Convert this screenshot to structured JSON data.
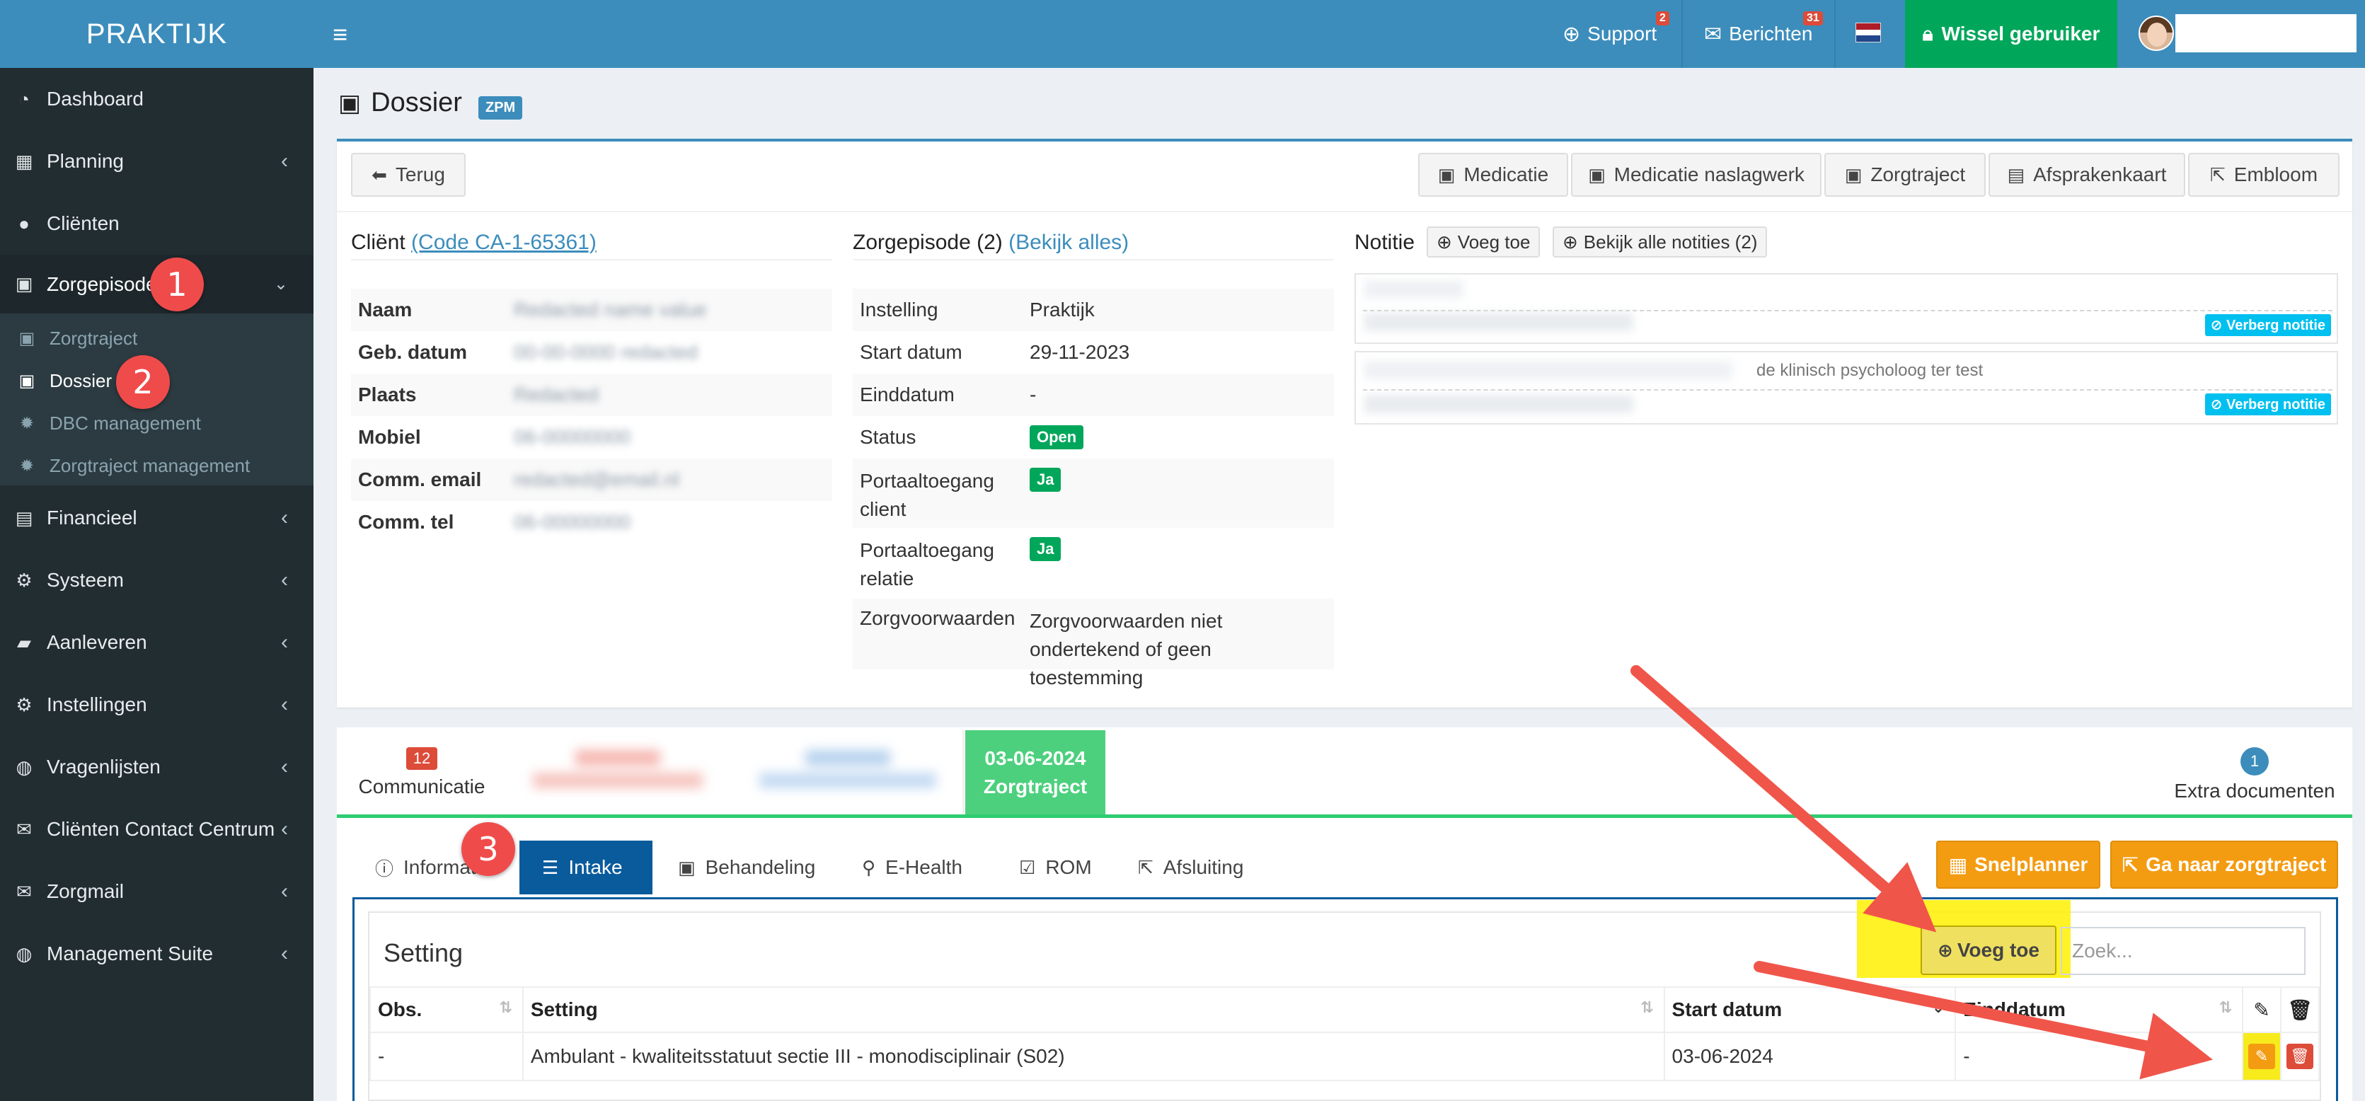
{
  "app": {
    "logo": "PRAKTIJK"
  },
  "sidebar": {
    "items": [
      {
        "label": "Dashboard",
        "icon": "dashboard-icon"
      },
      {
        "label": "Planning",
        "icon": "calendar-icon"
      },
      {
        "label": "Cliënten",
        "icon": "user-icon"
      },
      {
        "label": "Zorgepisode",
        "icon": "medkit-icon"
      },
      {
        "label": "Financieel",
        "icon": "book-icon"
      },
      {
        "label": "Systeem",
        "icon": "cogs-icon"
      },
      {
        "label": "Aanleveren",
        "icon": "truck-icon"
      },
      {
        "label": "Instellingen",
        "icon": "gear-icon"
      },
      {
        "label": "Vragenlijsten",
        "icon": "globe-icon"
      },
      {
        "label": "Cliënten Contact Centrum",
        "icon": "envelope-icon"
      },
      {
        "label": "Zorgmail",
        "icon": "envelope-icon"
      },
      {
        "label": "Management Suite",
        "icon": "globe-icon"
      }
    ],
    "submenu": [
      {
        "label": "Zorgtraject"
      },
      {
        "label": "Dossier"
      },
      {
        "label": "DBC management"
      },
      {
        "label": "Zorgtraject management"
      }
    ]
  },
  "topbar": {
    "support_label": "Support",
    "support_badge": "2",
    "messages_label": "Berichten",
    "messages_badge": "31",
    "switch_user_label": "Wissel gebruiker"
  },
  "page": {
    "title": "Dossier",
    "badge": "ZPM"
  },
  "actions": {
    "back": "Terug",
    "medication": "Medicatie",
    "medication_ref": "Medicatie naslagwerk",
    "care_track": "Zorgtraject",
    "appointment_card": "Afsprakenkaart",
    "embloom": "Embloom"
  },
  "client": {
    "title_prefix": "Cliënt",
    "code_link": "(Code CA-1-65361)",
    "rows": [
      {
        "key": "Naam",
        "value": "Redacted name value"
      },
      {
        "key": "Geb. datum",
        "value": "00-00-0000 redacted"
      },
      {
        "key": "Plaats",
        "value": "Redacted"
      },
      {
        "key": "Mobiel",
        "value": "06-00000000"
      },
      {
        "key": "Comm. email",
        "value": "redacted@email.nl"
      },
      {
        "key": "Comm. tel",
        "value": "06-00000000"
      }
    ]
  },
  "episode": {
    "title_prefix": "Zorgepisode (2)",
    "view_all": "(Bekijk alles)",
    "rows": [
      {
        "key": "Instelling",
        "value": "Praktijk"
      },
      {
        "key": "Start datum",
        "value": "29-11-2023"
      },
      {
        "key": "Einddatum",
        "value": "-"
      },
      {
        "key": "Status",
        "value": "Open"
      },
      {
        "key": "Portaaltoegang client",
        "value": "Ja"
      },
      {
        "key": "Portaaltoegang relatie",
        "value": "Ja"
      },
      {
        "key": "Zorgvoorwaarden",
        "value": "Zorgvoorwaarden niet ondertekend of geen toestemming"
      }
    ]
  },
  "notes": {
    "title": "Notitie",
    "add": "Voeg toe",
    "view_all": "Bekijk alle notities (2)",
    "hide_label": "Verberg notitie",
    "note2_visible_text": "de klinisch psycholoog ter test"
  },
  "bottom_tabs": {
    "communication_count": "12",
    "communication_label": "Communicatie",
    "active_date": "03-06-2024",
    "active_label": "Zorgtraject",
    "extra_count": "1",
    "extra_label": "Extra documenten"
  },
  "sub_tabs": [
    {
      "label": "Informatie",
      "icon": "info-icon"
    },
    {
      "label": "Intake",
      "icon": "sliders-icon"
    },
    {
      "label": "Behandeling",
      "icon": "medkit-icon"
    },
    {
      "label": "E-Health",
      "icon": "bicycle-icon"
    },
    {
      "label": "ROM",
      "icon": "check-square-icon"
    },
    {
      "label": "Afsluiting",
      "icon": "external-link-icon"
    }
  ],
  "planner": {
    "snelplanner": "Snelplanner",
    "goto": "Ga naar zorgtraject"
  },
  "setting": {
    "title": "Setting",
    "add": "Voeg toe",
    "search_placeholder": "Zoek...",
    "columns": [
      "Obs.",
      "Setting",
      "Start datum",
      "Einddatum"
    ],
    "rows": [
      {
        "obs": "-",
        "setting": "Ambulant - kwaliteitsstatuut sectie III - monodisciplinair (S02)",
        "start": "03-06-2024",
        "end": "-"
      }
    ]
  },
  "annotations": [
    "1",
    "2",
    "3"
  ]
}
